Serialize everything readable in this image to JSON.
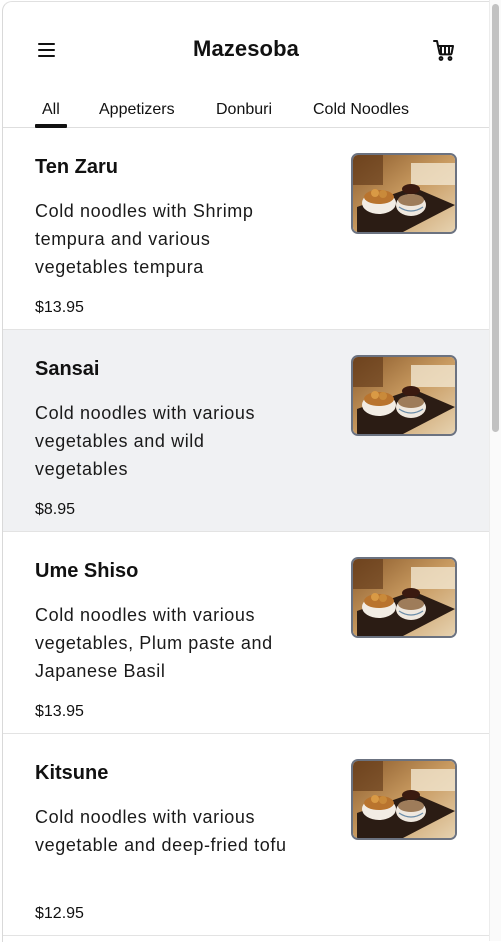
{
  "header": {
    "title": "Mazesoba",
    "menu_icon": "hamburger-menu-icon",
    "cart_icon": "shopping-cart-icon"
  },
  "tabs": [
    {
      "label": "All",
      "active": true
    },
    {
      "label": "Appetizers",
      "active": false
    },
    {
      "label": "Donburi",
      "active": false
    },
    {
      "label": "Cold Noodles",
      "active": false
    }
  ],
  "items": [
    {
      "name": "Ten Zaru",
      "description": "Cold noodles with Shrimp tempura and various vegetables tempura",
      "price": "$13.95"
    },
    {
      "name": "Sansai",
      "description": "Cold noodles with various vegetables and wild vegetables",
      "price": "$8.95"
    },
    {
      "name": "Ume Shiso",
      "description": "Cold noodles with various vegetables, Plum paste and Japanese Basil",
      "price": "$13.95"
    },
    {
      "name": "Kitsune",
      "description": "Cold noodles with various vegetable and deep-fried tofu",
      "price": "$12.95"
    }
  ],
  "colors": {
    "text": "#111111",
    "hover_row": "#f0f1f3",
    "divider": "#e3e3e3",
    "thumb_border": "#6b7280"
  }
}
